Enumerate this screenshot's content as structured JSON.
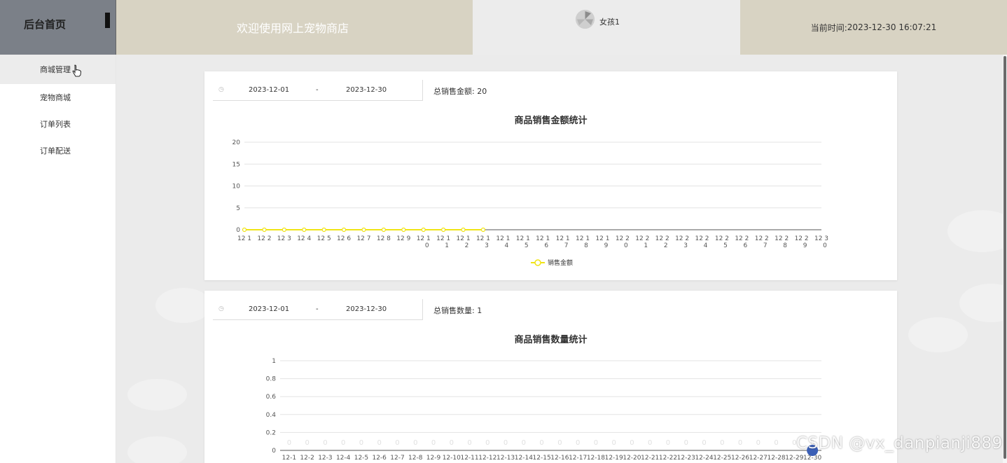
{
  "header": {
    "home_title": "后台首页",
    "welcome": "欢迎使用网上宠物商店",
    "username": "女孩1",
    "time_label": "当前时间:",
    "time_value": "2023-12-30 16:07:21"
  },
  "sidebar": {
    "items": [
      {
        "label": "商城管理"
      },
      {
        "label": "宠物商城"
      },
      {
        "label": "订单列表"
      },
      {
        "label": "订单配送"
      }
    ]
  },
  "card1": {
    "date_start": "2023-12-01",
    "date_sep": "-",
    "date_end": "2023-12-30",
    "total_label": "总销售金额:",
    "total_value": "20"
  },
  "card2": {
    "date_start": "2023-12-01",
    "date_sep": "-",
    "date_end": "2023-12-30",
    "total_label": "总销售数量:",
    "total_value": "1"
  },
  "watermark": "CSDN @vx_danpianji889",
  "colors": {
    "line_yellow": "#f0e415",
    "point_blue": "#3b5fb6"
  },
  "chart_data": [
    {
      "type": "line",
      "title": "商品销售金额统计",
      "categories": [
        "12-1",
        "12-2",
        "12-3",
        "12-4",
        "12-5",
        "12-6",
        "12-7",
        "12-8",
        "12-9",
        "12-10",
        "12-11",
        "12-12",
        "12-13",
        "12-14",
        "12-15",
        "12-16",
        "12-17",
        "12-18",
        "12-19",
        "12-20",
        "12-21",
        "12-22",
        "12-23",
        "12-24",
        "12-25",
        "12-26",
        "12-27",
        "12-28",
        "12-29",
        "12-30"
      ],
      "series": [
        {
          "name": "销售金额",
          "values": [
            0,
            0,
            0,
            0,
            0,
            0,
            0,
            0,
            0,
            0,
            0,
            0,
            0
          ]
        }
      ],
      "ylim": [
        0,
        20
      ],
      "yticks": [
        0,
        5,
        10,
        15,
        20
      ],
      "grid": true,
      "legend": "bottom-center"
    },
    {
      "type": "line",
      "title": "商品销售数量统计",
      "categories": [
        "12-1",
        "12-2",
        "12-3",
        "12-4",
        "12-5",
        "12-6",
        "12-7",
        "12-8",
        "12-9",
        "12-10",
        "12-11",
        "12-12",
        "12-13",
        "12-14",
        "12-15",
        "12-16",
        "12-17",
        "12-18",
        "12-19",
        "12-20",
        "12-21",
        "12-22",
        "12-23",
        "12-24",
        "12-25",
        "12-26",
        "12-27",
        "12-28",
        "12-29",
        "12-30"
      ],
      "series": [
        {
          "values": [
            0,
            0,
            0,
            0,
            0,
            0,
            0,
            0,
            0,
            0,
            0,
            0,
            0,
            0,
            0,
            0,
            0,
            0,
            0,
            0,
            0,
            0,
            0,
            0,
            0,
            0,
            0,
            0,
            0,
            0
          ]
        }
      ],
      "point_labels": [
        "0",
        "0",
        "0",
        "0",
        "0",
        "0",
        "0",
        "0",
        "0",
        "0",
        "0",
        "0",
        "0",
        "0",
        "0",
        "0",
        "0",
        "0",
        "0",
        "0",
        "0",
        "0",
        "0",
        "0",
        "0",
        "0",
        "0",
        "0",
        "0",
        "0"
      ],
      "ylim": [
        0,
        1
      ],
      "yticks": [
        "0",
        "0.2",
        "0.4",
        "0.6",
        "0.8",
        "1"
      ],
      "grid": true
    }
  ]
}
